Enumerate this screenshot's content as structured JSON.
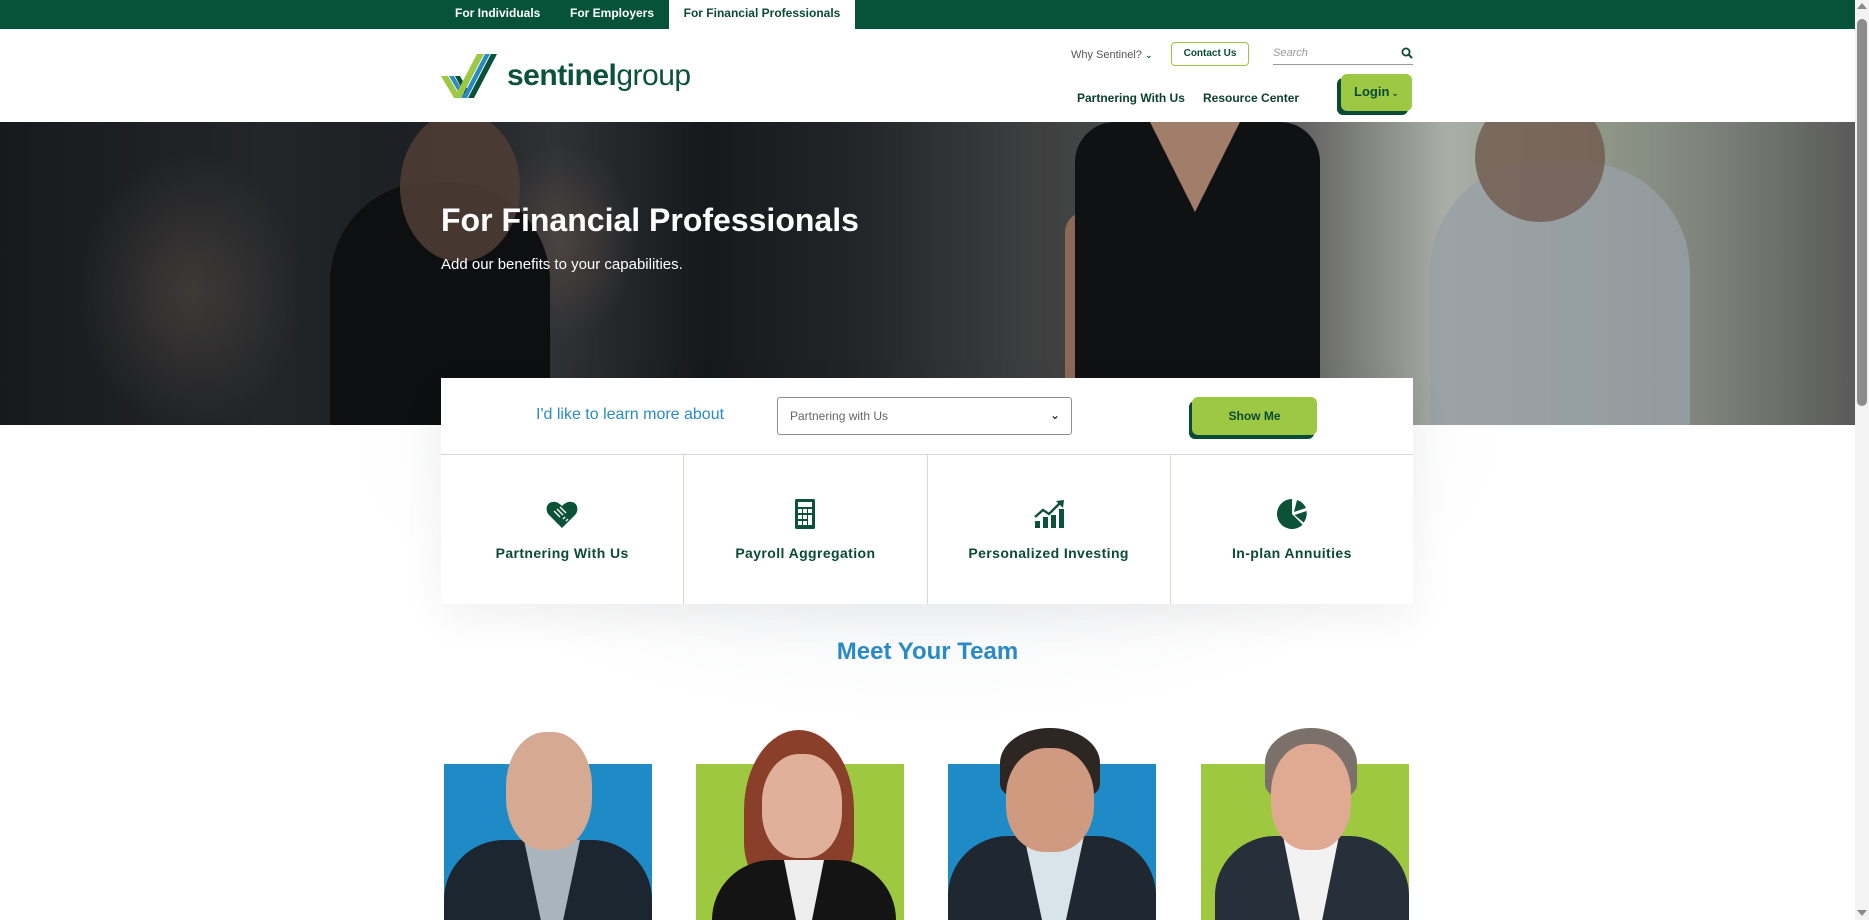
{
  "audience_tabs": [
    {
      "label": "For Individuals",
      "active": false
    },
    {
      "label": "For Employers",
      "active": false
    },
    {
      "label": "For Financial Professionals",
      "active": true
    }
  ],
  "header": {
    "logo": {
      "bold": "sentinel",
      "light": "group",
      "icon": "checkmark-stripes-logo"
    },
    "why_link": "Why Sentinel?",
    "contact_label": "Contact Us",
    "search_placeholder": "Search",
    "search_value": "",
    "nav": [
      "Partnering With Us",
      "Resource Center"
    ],
    "login_label": "Login"
  },
  "hero": {
    "title": "For Financial Professionals",
    "subtitle": "Add our benefits to your capabilities."
  },
  "learn_more": {
    "label": "I'd like to learn more about",
    "selected": "Partnering with Us",
    "button": "Show Me"
  },
  "cards": [
    {
      "label": "Partnering With Us",
      "icon": "handshake-heart-icon"
    },
    {
      "label": "Payroll Aggregation",
      "icon": "calculator-icon"
    },
    {
      "label": "Personalized Investing",
      "icon": "growth-chart-icon"
    },
    {
      "label": "In-plan Annuities",
      "icon": "pie-chart-icon"
    }
  ],
  "team": {
    "heading": "Meet Your Team",
    "members": [
      {
        "photo_bg": "#1e8ac6"
      },
      {
        "photo_bg": "#9dc83f"
      },
      {
        "photo_bg": "#1e8ac6"
      },
      {
        "photo_bg": "#9dc83f"
      }
    ]
  },
  "colors": {
    "brand_dark_green": "#06533a",
    "accent_lime": "#9cc843",
    "accent_blue": "#2a8ac4"
  }
}
